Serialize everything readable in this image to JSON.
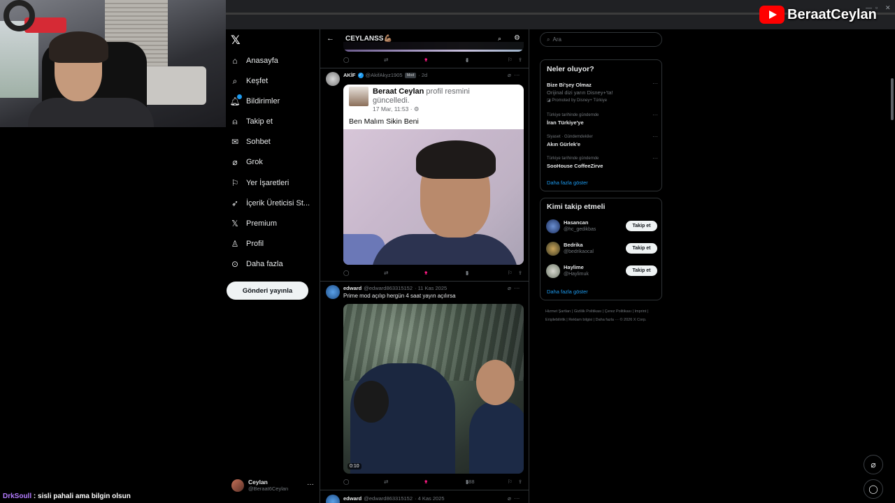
{
  "stream": {
    "channel_name": "BeraatCeylan",
    "chat": {
      "user": "DrkSoull",
      "message": " : sisli pahali ama bilgin olsun"
    }
  },
  "nav": {
    "items": [
      {
        "label": "Anasayfa",
        "icon": "home-icon"
      },
      {
        "label": "Keşfet",
        "icon": "search-icon"
      },
      {
        "label": "Bildirimler",
        "icon": "bell-icon"
      },
      {
        "label": "Takip et",
        "icon": "person-add-icon"
      },
      {
        "label": "Sohbet",
        "icon": "envelope-icon"
      },
      {
        "label": "Grok",
        "icon": "grok-icon"
      },
      {
        "label": "Yer İşaretleri",
        "icon": "bookmark-icon"
      },
      {
        "label": "İçerik Üreticisi St...",
        "icon": "rocket-icon"
      },
      {
        "label": "Premium",
        "icon": "x-icon"
      },
      {
        "label": "Profil",
        "icon": "person-icon"
      },
      {
        "label": "Daha fazla",
        "icon": "more-circle-icon"
      }
    ],
    "post_button": "Gönderi yayınla",
    "profile": {
      "name": "Ceylan",
      "handle": "@Beraat6Ceylan"
    }
  },
  "feed": {
    "title": "CEYLANSS💪🏽",
    "prev_tweet_actions": {
      "likes": "1",
      "views": "4"
    },
    "tweets": [
      {
        "name": "AKİF",
        "handle": "@AkifAkyz1905",
        "badge": "Mod",
        "time": "· 2d",
        "quote": {
          "name": "Beraat Ceylan",
          "action": " profil resmini",
          "action2": "güncelledi.",
          "date": "17 Mar, 11:53 · ⚙",
          "text": "Ben Malım Sikin Beni"
        },
        "likes": "1",
        "views": "5"
      },
      {
        "name": "edward",
        "handle": "@edward863315152",
        "time": "· 11 Kas 2025",
        "text": "Prime mod açılıp hergün 4 saat yayın açılırsa",
        "video_duration": "0:10",
        "likes": "1",
        "views": "588"
      },
      {
        "name": "edward",
        "handle": "@edward863315152",
        "time": "· 4 Kas 2025"
      }
    ]
  },
  "right": {
    "search_placeholder": "Ara",
    "trends_title": "Neler oluyor?",
    "trends": [
      {
        "title": "Bize Bi'şey Olmaz",
        "subtitle": "Orijinal dizi yarın Disney+'ta!",
        "promoted": "Promoted by Disney+ Türkiye"
      },
      {
        "context": "Türkiye tarihinde gündemde",
        "title": "İran Türkiye'ye"
      },
      {
        "context": "Siyaset · Gündemdekiler",
        "title": "Akın Gürlek'e"
      },
      {
        "context": "Türkiye tarihinde gündemde",
        "title": "SooHouse CoffeeZirve"
      }
    ],
    "trends_more": "Daha fazla göster",
    "who_title": "Kimi takip etmeli",
    "who": [
      {
        "name": "Hasancan",
        "handle": "@hc_gedikbas",
        "button": "Takip et"
      },
      {
        "name": "Bedrika",
        "handle": "@bedrikaocal",
        "button": "Takip et"
      },
      {
        "name": "Haylime",
        "handle": "@Haylimuk",
        "button": "Takip et"
      }
    ],
    "who_more": "Daha fazla göster",
    "footer": "Hizmet Şartları  |  Gizlilik Politikası  |  Çerez Politikası  |  Imprint  |  Erişilebilirlik  |  Reklam bilgisi  |  Daha fazla ···  © 2026 X Corp."
  },
  "colors": {
    "accent": "#1d9bf0",
    "like": "#f91880",
    "background": "#000000"
  }
}
